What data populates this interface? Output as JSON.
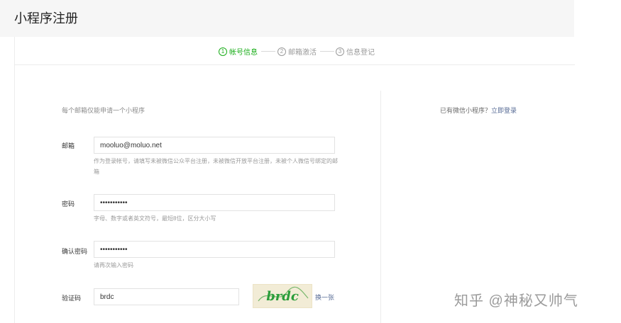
{
  "page": {
    "title": "小程序注册"
  },
  "steps": [
    {
      "num": "①",
      "label": "帐号信息",
      "active": true
    },
    {
      "num": "②",
      "label": "邮箱激活",
      "active": false
    },
    {
      "num": "③",
      "label": "信息登记",
      "active": false
    }
  ],
  "form": {
    "notice": "每个邮箱仅能申请一个小程序",
    "email": {
      "label": "邮箱",
      "value": "mooluo@moluo.net",
      "hint": "作为登录帐号，请填写未被微信公众平台注册，未被微信开放平台注册，未被个人微信号绑定的邮箱"
    },
    "password": {
      "label": "密码",
      "value": "•••••••••••",
      "hint": "字母、数字或者英文符号，最短8位，区分大小写"
    },
    "confirm": {
      "label": "确认密码",
      "value": "•••••••••••",
      "hint": "请再次输入密码"
    },
    "captcha": {
      "label": "验证码",
      "value": "brdc",
      "image_text": "brdc",
      "refresh_label": "换一张"
    }
  },
  "sidebar": {
    "prompt": "已有微信小程序？",
    "login_link": "立即登录"
  },
  "watermark": "知乎 @神秘又帅气",
  "colors": {
    "active_step": "#1aad19",
    "link": "#576b95",
    "header_bg": "#f6f6f6",
    "captcha_bg": "#f2ecd6",
    "captcha_text": "#2a9d3a"
  }
}
